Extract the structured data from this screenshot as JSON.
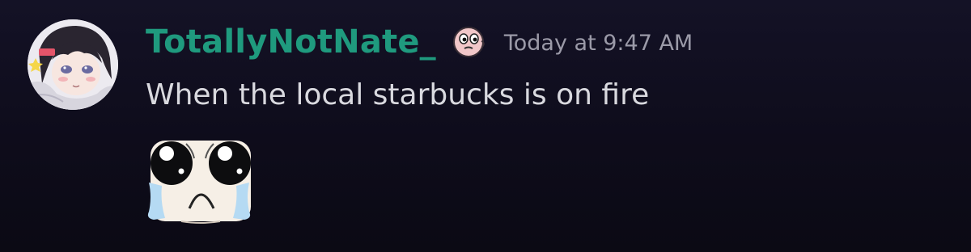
{
  "message": {
    "author": "TotallyNotNate_",
    "timestamp": "Today at 9:47 AM",
    "content": "When the local starbucks is on fire",
    "avatar_icon": "user-avatar-anime",
    "badge_icon": "pink-face-badge-icon",
    "attachment_icon": "crying-face-emoji",
    "colors": {
      "username": "#1f9a7e",
      "timestamp": "#9b9aa8",
      "text": "#d9d9df",
      "background": "#110f1f"
    }
  }
}
